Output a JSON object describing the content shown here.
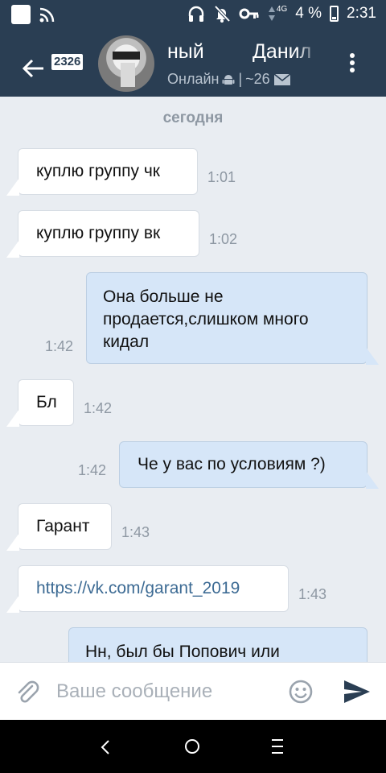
{
  "status_bar": {
    "network": "4G",
    "battery_percent": "4 %",
    "time": "2:31"
  },
  "header": {
    "unread_count": "2326",
    "title_part1": "ный",
    "title_part2": "Данил",
    "status": "Онлайн",
    "separator": "|",
    "mail_count": "~26"
  },
  "chat": {
    "date_separator": "сегодня",
    "messages": [
      {
        "direction": "in",
        "text": "куплю группу чк",
        "time": "1:01"
      },
      {
        "direction": "in",
        "text": "куплю группу вк",
        "time": "1:02"
      },
      {
        "direction": "out",
        "text": "Она больше не продается,слишком много кидал",
        "time": "1:42"
      },
      {
        "direction": "in",
        "text": "Бл",
        "time": "1:42"
      },
      {
        "direction": "out",
        "text": "Че у вас по условиям ?)",
        "time": "1:42"
      },
      {
        "direction": "in",
        "text": "Гарант",
        "time": "1:43"
      },
      {
        "direction": "in",
        "text": "https://vk.com/garant_2019",
        "time": "1:43"
      },
      {
        "direction": "out",
        "text": "Нн, был бы Попович или",
        "time": ""
      }
    ]
  },
  "input": {
    "placeholder": "Ваше сообщение",
    "value": ""
  },
  "colors": {
    "header_bg": "#2a3e53",
    "chat_bg": "#e9edf2",
    "incoming_bubble": "#ffffff",
    "outgoing_bubble": "#d6e6f8",
    "link": "#3d6b94",
    "time_text": "#8e98a3"
  },
  "icons": {
    "status_left": [
      "notification-square-icon",
      "wifi-icon"
    ],
    "status_right": [
      "headphones-icon",
      "bell-off-icon",
      "key-icon",
      "data-arrows-icon",
      "battery-icon"
    ],
    "header": [
      "back-arrow-icon",
      "android-icon",
      "mail-icon",
      "more-vertical-icon"
    ],
    "input_bar": [
      "paperclip-icon",
      "emoji-icon",
      "send-icon"
    ],
    "nav_bar": [
      "nav-back-icon",
      "nav-home-icon",
      "nav-recents-icon"
    ]
  }
}
